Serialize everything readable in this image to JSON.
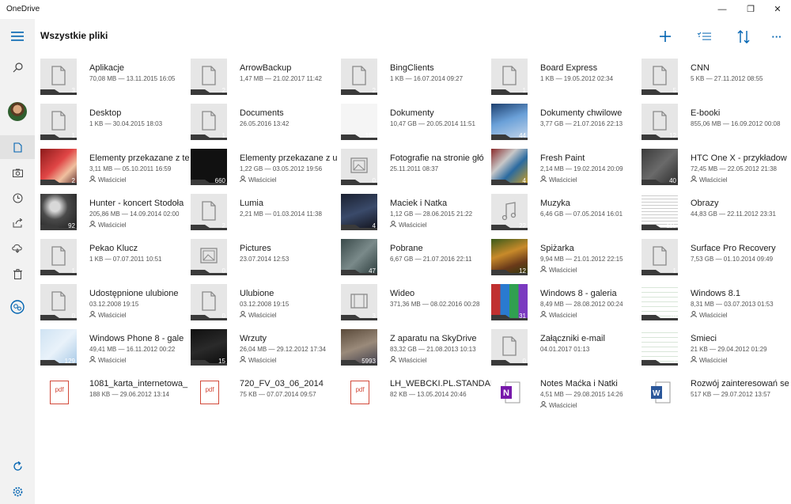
{
  "app": {
    "title": "OneDrive"
  },
  "window": {
    "minimize": "—",
    "restore": "❐",
    "close": "✕"
  },
  "header": {
    "title": "Wszystkie pliki"
  },
  "toolbar": {
    "more_label": "···"
  },
  "colors": {
    "accent": "#0063b1",
    "folder_bar": "#3a3a3a"
  },
  "sidebar": {
    "items": [
      {
        "icon": "hamburger-icon"
      },
      {
        "icon": "search-icon"
      },
      {
        "icon": "avatar"
      },
      {
        "icon": "files-icon"
      },
      {
        "icon": "photos-icon"
      },
      {
        "icon": "recent-icon"
      },
      {
        "icon": "shared-icon"
      },
      {
        "icon": "offline-icon"
      },
      {
        "icon": "recycle-bin-icon"
      },
      {
        "icon": "sharepoint-icon"
      },
      {
        "icon": "sync-icon"
      },
      {
        "icon": "settings-icon"
      }
    ]
  },
  "owner_label": "Właściciel",
  "files": [
    {
      "name": "Aplikacje",
      "meta": "70,08 MB — 13.11.2015 16:05",
      "count": "3",
      "kind": "folder"
    },
    {
      "name": "ArrowBackup",
      "meta": "1,47 MB — 21.02.2017 11:42",
      "count": "2",
      "kind": "folder"
    },
    {
      "name": "BingClients",
      "meta": "1 KB — 16.07.2014 09:27",
      "count": "2",
      "kind": "folder"
    },
    {
      "name": "Board Express",
      "meta": "1 KB — 19.05.2012 02:34",
      "count": "1",
      "kind": "folder"
    },
    {
      "name": "CNN",
      "meta": "5 KB — 27.11.2012 08:55",
      "count": "5",
      "kind": "folder"
    },
    {
      "name": "Desktop",
      "meta": "1 KB — 30.04.2015 18:03",
      "count": "1",
      "kind": "folder"
    },
    {
      "name": "Documents",
      "meta": "26.05.2016 13:42",
      "count": "1",
      "kind": "folder"
    },
    {
      "name": "Dokumenty",
      "meta": "10,47 GB — 20.05.2014 11:51",
      "count": "199",
      "kind": "image",
      "img": "img-white"
    },
    {
      "name": "Dokumenty chwilowe",
      "meta": "3,77 GB — 21.07.2016 22:13",
      "count": "44",
      "kind": "image",
      "img": "img-blue"
    },
    {
      "name": "E-booki",
      "meta": "855,06 MB — 16.09.2012 00:08",
      "count": "12",
      "kind": "folder"
    },
    {
      "name": "Elementy przekazane z te",
      "meta": "3,11 MB — 05.10.2011 16:59",
      "count": "2",
      "kind": "image",
      "img": "img-red",
      "owner": true
    },
    {
      "name": "Elementy przekazane z u",
      "meta": "1,22 GB — 03.05.2012 19:56",
      "count": "660",
      "kind": "image",
      "img": "img-elem2",
      "owner": true
    },
    {
      "name": "Fotografie na stronie głó",
      "meta": "25.11.2011 08:37",
      "count": "0",
      "kind": "photo"
    },
    {
      "name": "Fresh Paint",
      "meta": "2,14 MB — 19.02.2014 20:09",
      "count": "4",
      "kind": "image",
      "img": "img-fresh",
      "owner": true
    },
    {
      "name": "HTC One X - przykładow",
      "meta": "72,45 MB — 22.05.2012 21:38",
      "count": "40",
      "kind": "image",
      "img": "img-htc",
      "owner": true
    },
    {
      "name": "Hunter - koncert Stodoła",
      "meta": "205,86 MB — 14.09.2014 02:00",
      "count": "92",
      "kind": "image",
      "img": "img-concert",
      "owner": true
    },
    {
      "name": "Lumia",
      "meta": "2,21 MB — 01.03.2014 11:38",
      "count": "2",
      "kind": "folder"
    },
    {
      "name": "Maciek i Natka",
      "meta": "1,12 GB — 28.06.2015 21:22",
      "count": "4",
      "kind": "image",
      "img": "img-man",
      "owner": true
    },
    {
      "name": "Muzyka",
      "meta": "6,46 GB — 07.05.2014 16:01",
      "count": "22",
      "kind": "music"
    },
    {
      "name": "Obrazy",
      "meta": "44,83 GB — 22.11.2012 23:31",
      "count": "115",
      "kind": "image",
      "img": "img-scan"
    },
    {
      "name": "Pekao Klucz",
      "meta": "1 KB — 07.07.2011 10:51",
      "count": "1",
      "kind": "folder"
    },
    {
      "name": "Pictures",
      "meta": "23.07.2014 12:53",
      "count": "0",
      "kind": "photo"
    },
    {
      "name": "Pobrane",
      "meta": "6,67 GB — 21.07.2016 22:11",
      "count": "47",
      "kind": "image",
      "img": "img-pobrane"
    },
    {
      "name": "Spiżarka",
      "meta": "9,94 MB — 21.01.2012 22:15",
      "count": "12",
      "kind": "image",
      "img": "img-forest",
      "owner": true
    },
    {
      "name": "Surface Pro Recovery",
      "meta": "7,53 GB — 01.10.2014 09:49",
      "count": "1",
      "kind": "folder"
    },
    {
      "name": "Udostępnione ulubione",
      "meta": "03.12.2008 19:15",
      "count": "0",
      "kind": "folder",
      "owner": true
    },
    {
      "name": "Ulubione",
      "meta": "03.12.2008 19:15",
      "count": "0",
      "kind": "folder",
      "owner": true
    },
    {
      "name": "Wideo",
      "meta": "371,36 MB — 08.02.2016 00:28",
      "count": "3",
      "kind": "video"
    },
    {
      "name": "Windows 8 - galeria",
      "meta": "8,49 MB — 28.08.2012 00:24",
      "count": "31",
      "kind": "image",
      "img": "img-tiles",
      "owner": true
    },
    {
      "name": "Windows 8.1",
      "meta": "8,31 MB — 03.07.2013 01:53",
      "count": "16",
      "kind": "image",
      "img": "img-table",
      "owner": true
    },
    {
      "name": "Windows Phone 8 - gale",
      "meta": "49,41 MB — 16.11.2012 00:22",
      "count": "129",
      "kind": "image",
      "img": "img-map",
      "owner": true
    },
    {
      "name": "Wrzuty",
      "meta": "26,04 MB — 29.12.2012 17:34",
      "count": "15",
      "kind": "image",
      "img": "img-phone",
      "owner": true
    },
    {
      "name": "Z aparatu na SkyDrive",
      "meta": "83,32 GB — 21.08.2013 10:13",
      "count": "5993",
      "kind": "image",
      "img": "img-hand",
      "owner": true
    },
    {
      "name": "Załączniki e-mail",
      "meta": "04.01.2017 01:13",
      "count": "0",
      "kind": "folder"
    },
    {
      "name": "Śmieci",
      "meta": "21 KB — 29.04.2012 01:29",
      "count": "1",
      "kind": "image",
      "img": "img-table",
      "owner": true
    },
    {
      "name": "1081_karta_internetowa_",
      "meta": "188 KB — 29.06.2012 13:14",
      "count": "",
      "kind": "pdf"
    },
    {
      "name": "720_FV_03_06_2014",
      "meta": "75 KB — 07.07.2014 09:57",
      "count": "",
      "kind": "pdf"
    },
    {
      "name": "LH_WEBCKI.PL.STANDAR",
      "meta": "82 KB — 13.05.2014 20:46",
      "count": "",
      "kind": "pdf"
    },
    {
      "name": "Notes Maćka i Natki",
      "meta": "4,51 MB — 29.08.2015 14:26",
      "count": "",
      "kind": "onenote",
      "owner": true
    },
    {
      "name": "Rozwój zainteresowań se",
      "meta": "517 KB — 29.07.2012 13:57",
      "count": "",
      "kind": "word"
    }
  ],
  "pdf_label": "pdf"
}
